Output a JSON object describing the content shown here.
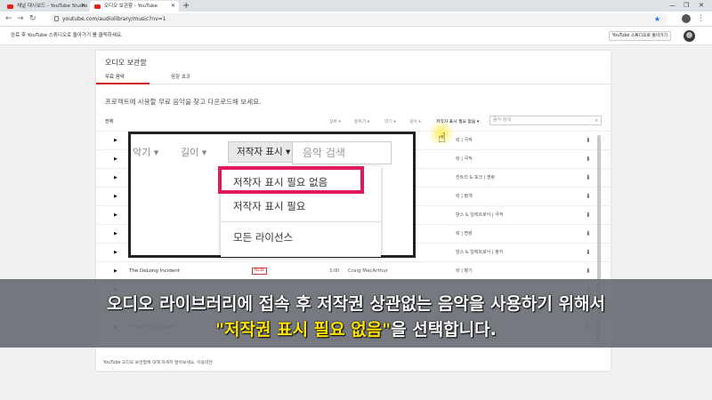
{
  "browser": {
    "tabs": [
      {
        "label": "채널 대시보드 - YouTube Studio"
      },
      {
        "label": "오디오 보관함 - YouTube"
      }
    ],
    "new_tab": "+",
    "url": "youtube.com/audiolibrary/music?nv=1"
  },
  "notice": {
    "text": "완료 후 YouTube 스튜디오로 돌아가기 를 클릭하세요.",
    "button": "YouTube 스튜디오로 돌아가기"
  },
  "page": {
    "title": "오디오 보관함",
    "tabs": [
      "무료 음악",
      "음향 효과"
    ],
    "description": "프로젝트에 사용할 무료 음악을 찾고 다운로드해 보세요.",
    "filters": {
      "all": "전체",
      "genre": "장르 ▾",
      "mood": "분위기 ▾",
      "instrument": "악기 ▾",
      "length": "길이 ▾",
      "attribution": "저작자 표시 필요 없음 ▾",
      "search_placeholder": "음악 검색"
    },
    "rows": [
      {
        "title": "",
        "badge": "",
        "duration": "",
        "artist": "",
        "genre": "락 | 극적"
      },
      {
        "title": "",
        "badge": "",
        "duration": "",
        "artist": "",
        "genre": "락 | 극적"
      },
      {
        "title": "",
        "badge": "",
        "duration": "",
        "artist": "",
        "genre": "컨트리 & 포크 | 명랑"
      },
      {
        "title": "",
        "badge": "",
        "duration": "",
        "artist": "",
        "genre": "락 | 평개"
      },
      {
        "title": "",
        "badge": "",
        "duration": "",
        "artist": "",
        "genre": "댄스 & 일렉트로닉 | 극적"
      },
      {
        "title": "",
        "badge": "",
        "duration": "",
        "artist": "",
        "genre": "락 | 명랑"
      },
      {
        "title": "",
        "badge": "",
        "duration": "",
        "artist": "",
        "genre": "댄스 & 일렉트로닉 | 펑키"
      },
      {
        "title": "The DeLong Incident",
        "badge": "NEW",
        "duration": "3:00",
        "artist": "Craig MacArthur",
        "genre": "락 | 평기"
      },
      {
        "title": "",
        "badge": "",
        "duration": "",
        "artist": "",
        "genre": ""
      },
      {
        "title": "Gato Searching for the Truth",
        "badge": "",
        "duration": "",
        "artist": "",
        "genre": ""
      },
      {
        "title": "I Pound DB Cooper",
        "badge": "",
        "duration": "",
        "artist": "Craig MacArthur",
        "genre": "락 | 극적"
      }
    ],
    "footer": "YouTube 오디오 보관함에 대해 자세히 알아보세요. 이용약관"
  },
  "zoom": {
    "instrument": "악기 ▾",
    "length": "길이 ▾",
    "attribution": "저작자 표시 ▾",
    "search_placeholder": "음악 검색",
    "options": [
      "저작자 표시 필요 없음",
      "저작자 표시 필요",
      "모든 라이선스"
    ]
  },
  "caption": {
    "line1": "오디오 라이브러리에 접속 후 저작권 상관없는 음악을 사용하기 위해서",
    "line2_highlight": "\"저작권 표시 필요 없음\"",
    "line2_rest": "을 선택합니다."
  },
  "colors": {
    "highlight_box": "#e0195a",
    "caption_highlight": "#ffe600",
    "youtube_red": "#e62117"
  }
}
